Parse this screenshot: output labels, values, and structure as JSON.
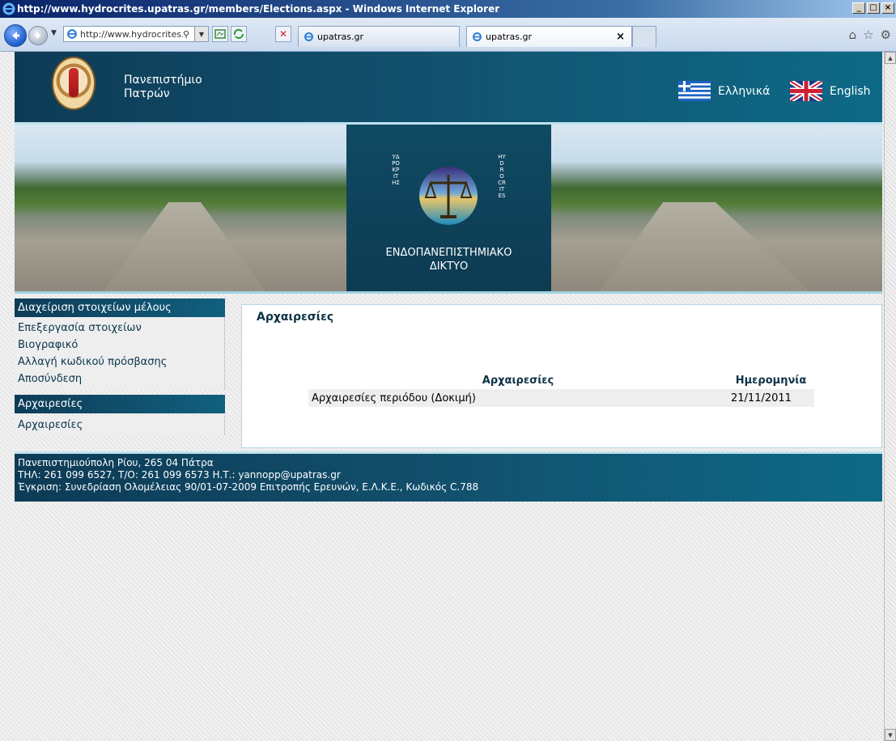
{
  "window": {
    "title": "http://www.hydrocrites.upatras.gr/members/Elections.aspx - Windows Internet Explorer",
    "min": "_",
    "max": "□",
    "close": "×"
  },
  "toolbar": {
    "address": "http://www.hydrocrites.",
    "tabs": [
      {
        "label": "upatras.gr"
      },
      {
        "label": "upatras.gr"
      }
    ],
    "tab_close": "×"
  },
  "header": {
    "university_line1": "Πανεπιστήμιο",
    "university_line2": "Πατρών",
    "lang_greek": "Ελληνικά",
    "lang_english": "English"
  },
  "banner": {
    "network_line1": "ΕΝΔΟΠΑΝΕΠΙΣΤΗΜΙΑΚΟ",
    "network_line2": "ΔΙΚΤΥΟ",
    "logo_left_text": "ΥΔΡΟΚΡΙΤΗΣ",
    "logo_right_text": "HYDROCRITES"
  },
  "sidebar": {
    "section1_title": "Διαχείριση στοιχείων μέλους",
    "section1_items": [
      {
        "label": "Επεξεργασία στοιχείων"
      },
      {
        "label": "Βιογραφικό"
      },
      {
        "label": "Αλλαγή κωδικού πρόσβασης"
      },
      {
        "label": "Αποσύνδεση"
      }
    ],
    "section2_title": "Αρχαιρεσίες",
    "section2_items": [
      {
        "label": "Αρχαιρεσίες"
      }
    ]
  },
  "main": {
    "title": "Αρχαιρεσίες",
    "table": {
      "headers": [
        "Αρχαιρεσίες",
        "Ημερομηνία"
      ],
      "rows": [
        {
          "name": "Αρχαιρεσίες περιόδου (Δοκιμή)",
          "date": "21/11/2011"
        }
      ]
    }
  },
  "footer": {
    "line1": "Πανεπιστημιούπολη Ρίου, 265 04 Πάτρα",
    "line2": "ΤΗΛ: 261 099 6527, Τ/Ο: 261 099 6573 Η.Τ.:  yannopp@upatras.gr",
    "line3": "Έγκριση: Συνεδρίαση Ολομέλειας 90/01-07-2009 Επιτροπής Ερευνών, Ε.Λ.Κ.Ε., Κωδικός C.788"
  },
  "colors": {
    "header_dark": "#0d3b56",
    "header_light": "#0d6a87",
    "link": "#08354d"
  }
}
